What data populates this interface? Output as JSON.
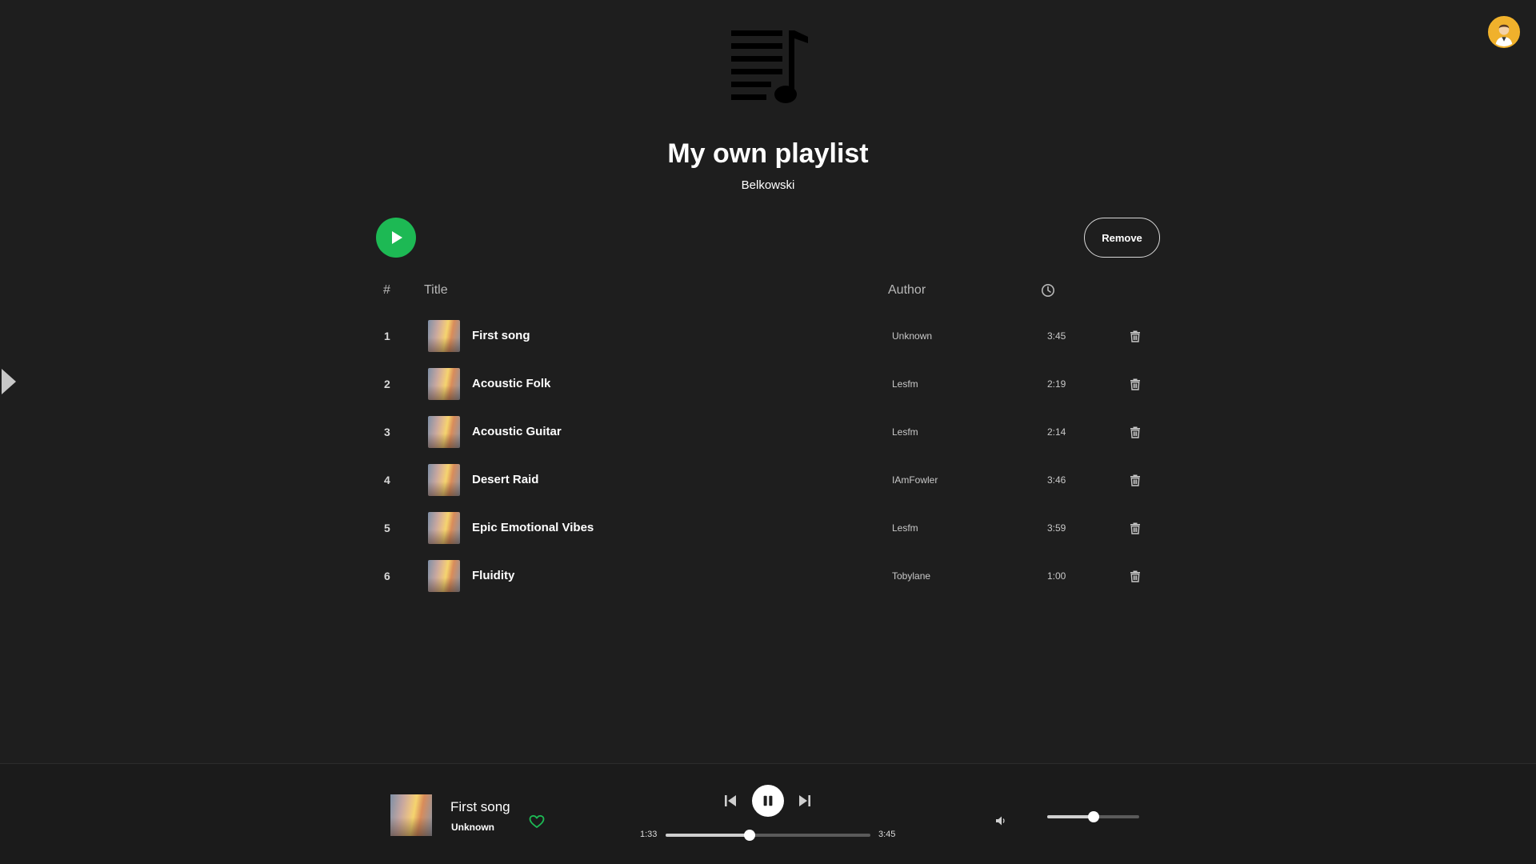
{
  "user": {
    "avatar_icon": "user-avatar-icon"
  },
  "playlist": {
    "title": "My own playlist",
    "owner": "Belkowski",
    "cover_icon": "playlist-music-icon",
    "remove_label": "Remove"
  },
  "table": {
    "header": {
      "num": "#",
      "title": "Title",
      "author": "Author",
      "duration_icon": "clock-icon"
    },
    "rows": [
      {
        "num": "1",
        "title": "First song",
        "author": "Unknown",
        "duration": "3:45"
      },
      {
        "num": "2",
        "title": "Acoustic Folk",
        "author": "Lesfm",
        "duration": "2:19"
      },
      {
        "num": "3",
        "title": "Acoustic Guitar",
        "author": "Lesfm",
        "duration": "2:14"
      },
      {
        "num": "4",
        "title": "Desert Raid",
        "author": "IAmFowler",
        "duration": "3:46"
      },
      {
        "num": "5",
        "title": "Epic Emotional Vibes",
        "author": "Lesfm",
        "duration": "3:59"
      },
      {
        "num": "6",
        "title": "Fluidity",
        "author": "Tobylane",
        "duration": "1:00"
      }
    ]
  },
  "player": {
    "title": "First song",
    "artist": "Unknown",
    "current_time": "1:33",
    "total_time": "3:45",
    "progress_fraction": 0.41,
    "volume_fraction": 0.5,
    "liked": true
  },
  "colors": {
    "background": "#1e1e1e",
    "accent": "#1db954",
    "text": "#ffffff",
    "muted": "#b8b8b8"
  }
}
